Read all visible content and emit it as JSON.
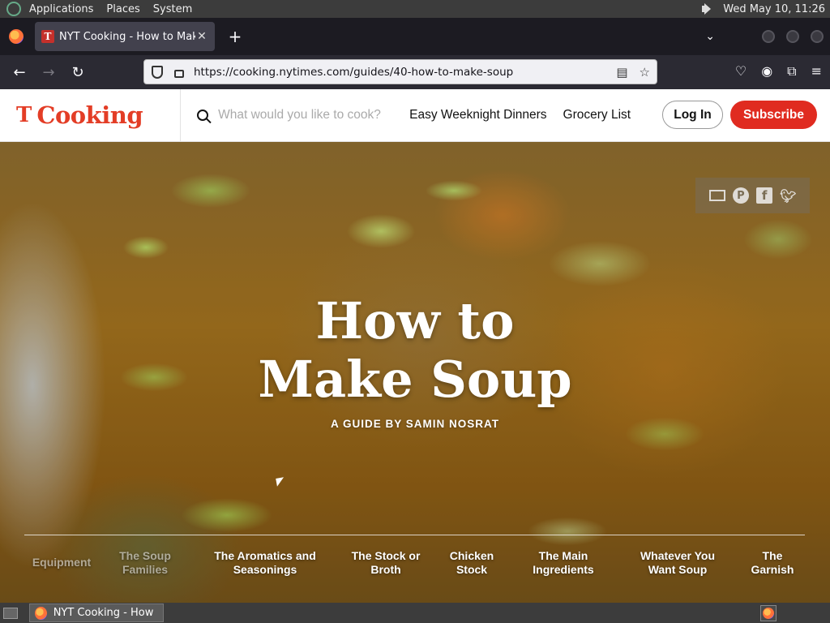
{
  "system_panel": {
    "menus": [
      "Applications",
      "Places",
      "System"
    ],
    "clock": "Wed May 10, 11:26"
  },
  "browser": {
    "tab_title": "NYT Cooking - How to Make Soup",
    "tab_favicon": "T",
    "url": "https://cooking.nytimes.com/guides/40-how-to-make-soup"
  },
  "site": {
    "logo_mark": "T",
    "logo_word": "Cooking",
    "search_placeholder": "What would you like to cook?",
    "links": [
      "Easy Weeknight Dinners",
      "Grocery List"
    ],
    "login_label": "Log In",
    "subscribe_label": "Subscribe",
    "accent_color": "#e02b20"
  },
  "hero": {
    "title_line1": "How to",
    "title_line2": "Make Soup",
    "subtitle": "A GUIDE BY SAMIN NOSRAT",
    "share_icons": [
      "mail-icon",
      "pinterest-icon",
      "facebook-icon",
      "twitter-icon"
    ],
    "chapters": [
      {
        "label": "Equipment"
      },
      {
        "label": "The Soup Families"
      },
      {
        "label": "The Aromatics and Seasonings"
      },
      {
        "label": "The Stock or Broth"
      },
      {
        "label": "Chicken Stock"
      },
      {
        "label": "The Main Ingredients"
      },
      {
        "label": "Whatever You Want Soup"
      },
      {
        "label": "The Garnish"
      }
    ]
  },
  "taskbar": {
    "task_label": "NYT Cooking - How …"
  }
}
